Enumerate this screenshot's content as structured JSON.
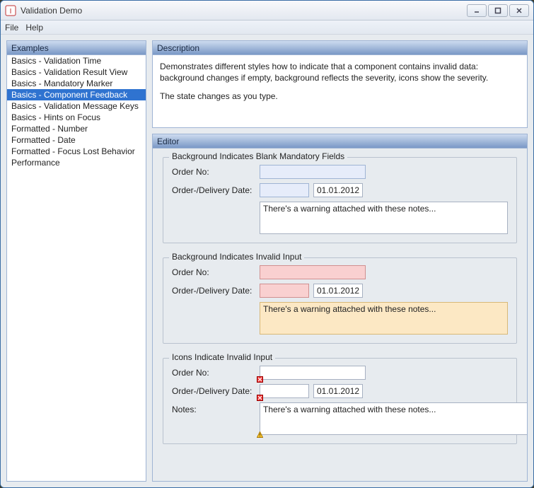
{
  "window": {
    "title": "Validation Demo"
  },
  "menubar": {
    "file": "File",
    "help": "Help"
  },
  "sidebar": {
    "header": "Examples",
    "items": [
      {
        "label": "Basics - Validation Time",
        "selected": false
      },
      {
        "label": "Basics - Validation Result View",
        "selected": false
      },
      {
        "label": "Basics - Mandatory Marker",
        "selected": false
      },
      {
        "label": "Basics - Component Feedback",
        "selected": true
      },
      {
        "label": "Basics - Validation Message Keys",
        "selected": false
      },
      {
        "label": "Basics - Hints on Focus",
        "selected": false
      },
      {
        "label": "Formatted - Number",
        "selected": false
      },
      {
        "label": "Formatted - Date",
        "selected": false
      },
      {
        "label": "Formatted - Focus Lost Behavior",
        "selected": false
      },
      {
        "label": "Performance",
        "selected": false
      }
    ]
  },
  "description": {
    "header": "Description",
    "line1": "Demonstrates different styles how to indicate that a component contains invalid data: background changes if empty, background reflects the severity, icons show the severity.",
    "line2": "The state changes as you type."
  },
  "editor": {
    "header": "Editor",
    "groups": {
      "blank": {
        "legend": "Background Indicates Blank Mandatory Fields",
        "orderNoLabel": "Order No:",
        "orderNoValue": "",
        "dateLabel": "Order-/Delivery Date:",
        "date1": "",
        "date2": "01.01.2012",
        "notesValue": "There's a warning attached with these notes..."
      },
      "invalid": {
        "legend": "Background Indicates Invalid Input",
        "orderNoLabel": "Order No:",
        "orderNoValue": "",
        "dateLabel": "Order-/Delivery Date:",
        "date1": "",
        "date2": "01.01.2012",
        "notesValue": "There's a warning attached with these notes..."
      },
      "icons": {
        "legend": "Icons Indicate Invalid Input",
        "orderNoLabel": "Order No:",
        "orderNoValue": "",
        "dateLabel": "Order-/Delivery Date:",
        "date1": "",
        "date2": "01.01.2012",
        "notesLabel": "Notes:",
        "notesValue": "There's a warning attached with these notes..."
      }
    }
  },
  "iconNames": {
    "error": "error-icon",
    "warning": "warning-icon"
  },
  "colors": {
    "blankFieldBg": "#e6ecfa",
    "errorFieldBg": "#f9d0d0",
    "warnFieldBg": "#fce8c4",
    "selection": "#2f73d0"
  }
}
